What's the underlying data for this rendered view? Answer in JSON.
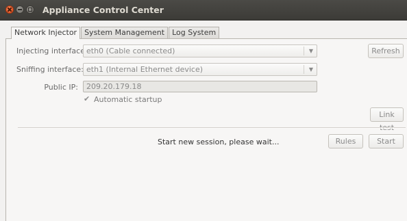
{
  "window": {
    "title": "Appliance Control Center"
  },
  "tabs": [
    {
      "label": "Network Injector",
      "active": true
    },
    {
      "label": "System Management",
      "active": false
    },
    {
      "label": "Log System",
      "active": false
    }
  ],
  "injector": {
    "injecting_label": "Injecting interface:",
    "injecting_value": "eth0 (Cable connected)",
    "sniffing_label": "Sniffing interface:",
    "sniffing_value": "eth1 (Internal Ethernet device)",
    "public_ip_label": "Public IP:",
    "public_ip_value": "209.20.179.18",
    "automatic_startup_label": "Automatic startup",
    "automatic_startup_checked": true,
    "refresh_label": "Refresh",
    "link_test_label": "Link test",
    "status_text": "Start new session, please wait...",
    "rules_label": "Rules",
    "start_label": "Start"
  },
  "icons": {
    "close": "close-icon",
    "minimize": "minimize-icon",
    "maximize": "maximize-icon",
    "dropdown": "chevron-down-icon",
    "check": "check-icon"
  },
  "colors": {
    "titlebar": "#3c3b37",
    "close_button": "#df4a16",
    "window_bg": "#f2f1f0"
  }
}
